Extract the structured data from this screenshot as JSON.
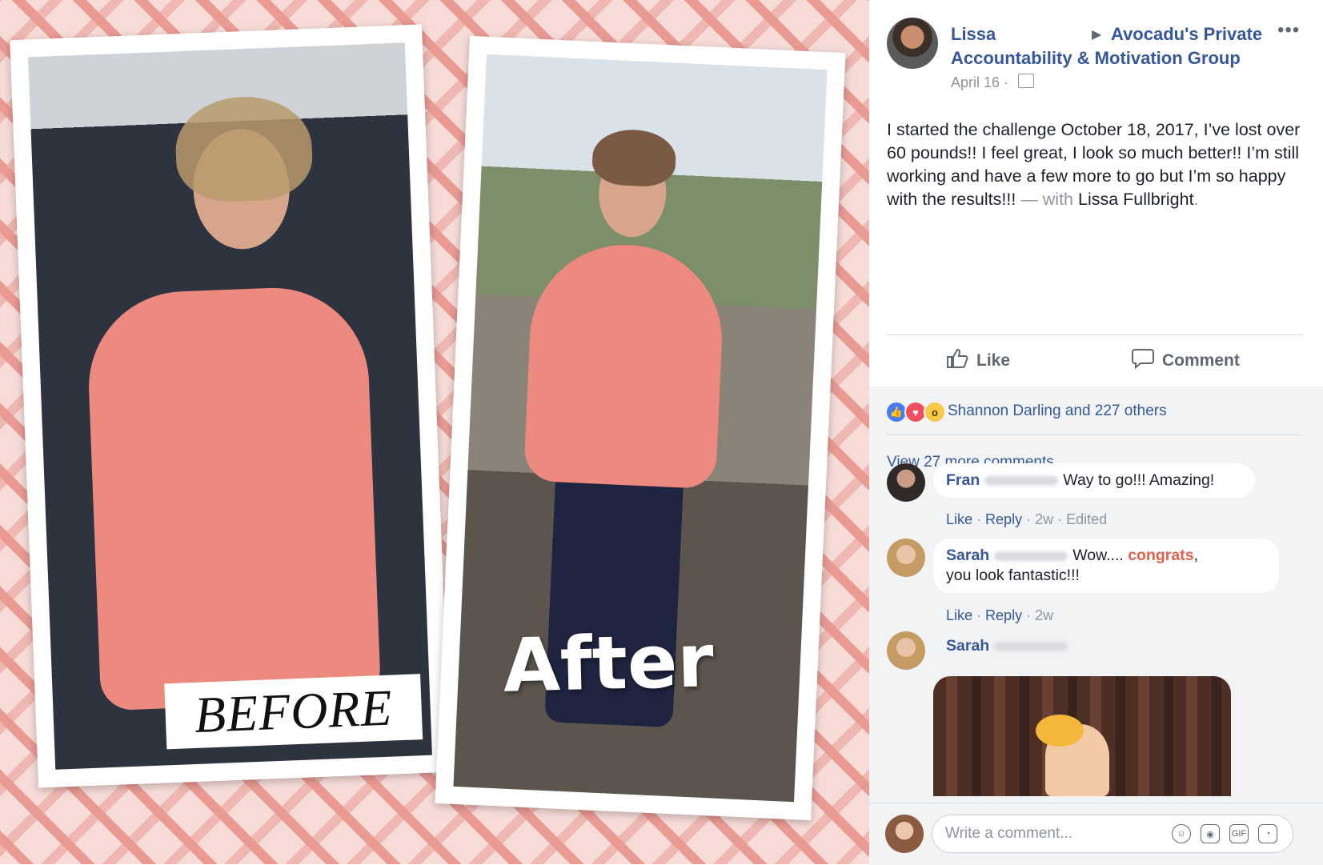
{
  "photo": {
    "before_label": "BEFORE",
    "after_label": "After"
  },
  "post": {
    "author": "Lissa",
    "group_line1": "Avocadu's Private",
    "group_line2": "Accountability & Motivation Group",
    "date": "April 16 ·",
    "text_main": "I started the challenge October 18, 2017, I’ve lost over 60 pounds!! I feel great, I look so much better!! I’m still working and have a few more to go but I’m so happy with the results!!!",
    "text_with": " — with ",
    "tagged": "Lissa Fullbright",
    "text_end": "."
  },
  "actions": {
    "like": "Like",
    "comment": "Comment"
  },
  "reactions": {
    "summary": "Shannon Darling and 227 others"
  },
  "comments": {
    "view_more": "View 27 more comments",
    "items": [
      {
        "name": "Fran",
        "text": "Way to go!!! Amazing!",
        "like": "Like",
        "reply": "Reply",
        "time": "2w",
        "edited": "Edited"
      },
      {
        "name": "Sarah",
        "text_before": "Wow.... ",
        "highlight": "congrats",
        "text_after": ",",
        "text_line2": "you look fantastic!!!",
        "like": "Like",
        "reply": "Reply",
        "time": "2w"
      },
      {
        "name": "Sarah"
      }
    ]
  },
  "composer": {
    "placeholder": "Write a comment..."
  }
}
